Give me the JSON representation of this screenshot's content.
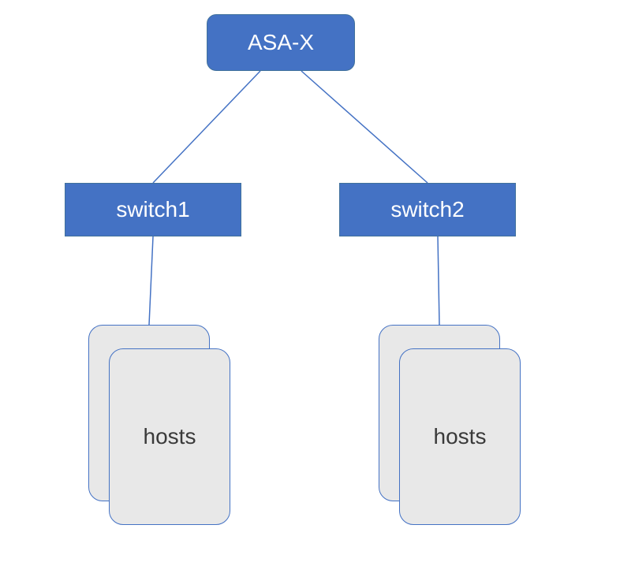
{
  "diagram": {
    "top_node_label": "ASA-X",
    "switches": [
      {
        "label": "switch1"
      },
      {
        "label": "switch2"
      }
    ],
    "host_groups": [
      {
        "label": "hosts"
      },
      {
        "label": "hosts"
      }
    ],
    "colors": {
      "node_fill": "#4472C4",
      "node_border": "#41719C",
      "card_fill": "#E8E8E8",
      "card_border": "#4472C4",
      "connector": "#4472C4"
    }
  }
}
